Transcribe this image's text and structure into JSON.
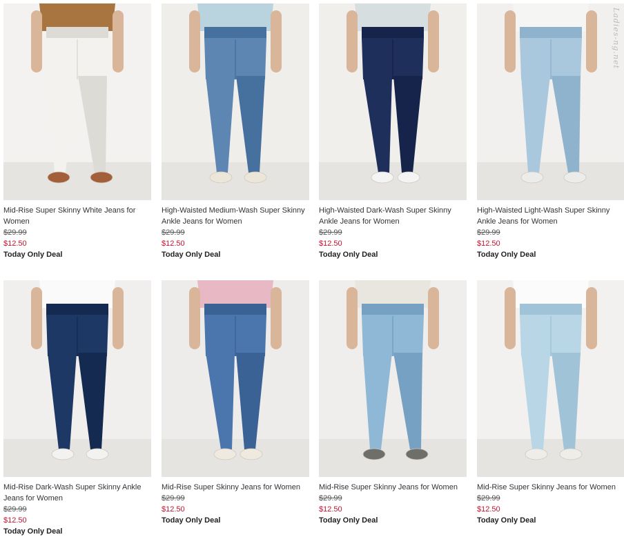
{
  "products": [
    {
      "title": "Mid-Rise Super Skinny White Jeans for Women",
      "original_price": "$29.99",
      "sale_price": "$12.50",
      "deal_label": "Today Only Deal",
      "colors": {
        "jeans": "#f3f2ee",
        "jeans_shade": "#dddbd5",
        "top": "#a8743f",
        "shoe": "#a35e3a",
        "bg": "#f3f2f0"
      }
    },
    {
      "title": "High-Waisted Medium-Wash Super Skinny Ankle Jeans for Women",
      "original_price": "$29.99",
      "sale_price": "$12.50",
      "deal_label": "Today Only Deal",
      "colors": {
        "jeans": "#5d86b3",
        "jeans_shade": "#46709e",
        "top": "#b9d3df",
        "shoe": "#ebe6d8",
        "bg": "#efeeeb"
      }
    },
    {
      "title": "High-Waisted Dark-Wash Super Skinny Ankle Jeans for Women",
      "original_price": "$29.99",
      "sale_price": "$12.50",
      "deal_label": "Today Only Deal",
      "colors": {
        "jeans": "#1f2f5c",
        "jeans_shade": "#16234a",
        "top": "#d7dee0",
        "shoe": "#f4f4f4",
        "bg": "#f0efec"
      }
    },
    {
      "title": "High-Waisted Light-Wash Super Skinny Ankle Jeans for Women",
      "original_price": "$29.99",
      "sale_price": "$12.50",
      "deal_label": "Today Only Deal",
      "watermark": "Ladies-ng.net",
      "colors": {
        "jeans": "#a9c8dd",
        "jeans_shade": "#8fb3cc",
        "top": "#f5f5f3",
        "shoe": "#ececea",
        "bg": "#f1f0ee"
      }
    },
    {
      "title": "Mid-Rise Dark-Wash Super Skinny Ankle Jeans for Women",
      "original_price": "$29.99",
      "sale_price": "$12.50",
      "deal_label": "Today Only Deal",
      "colors": {
        "jeans": "#1e3866",
        "jeans_shade": "#152a51",
        "top": "#fafafa",
        "shoe": "#f2f2f0",
        "bg": "#f0efed"
      }
    },
    {
      "title": "Mid-Rise Super Skinny Jeans for Women",
      "original_price": "$29.99",
      "sale_price": "$12.50",
      "deal_label": "Today Only Deal",
      "colors": {
        "jeans": "#4a76ad",
        "jeans_shade": "#3a6295",
        "top": "#e8b8c4",
        "shoe": "#eeeae0",
        "bg": "#edeceb"
      }
    },
    {
      "title": "Mid-Rise Super Skinny Jeans for Women",
      "original_price": "$29.99",
      "sale_price": "$12.50",
      "deal_label": "Today Only Deal",
      "colors": {
        "jeans": "#8fb8d6",
        "jeans_shade": "#76a1c2",
        "top": "#e9e6df",
        "shoe": "#6e6e6a",
        "bg": "#efeeec"
      }
    },
    {
      "title": "Mid-Rise Super Skinny Jeans for Women",
      "original_price": "$29.99",
      "sale_price": "$12.50",
      "deal_label": "Today Only Deal",
      "colors": {
        "jeans": "#b9d6e6",
        "jeans_shade": "#a0c3d7",
        "top": "#fbfbfb",
        "shoe": "#efedea",
        "bg": "#f2f1ef"
      }
    }
  ]
}
